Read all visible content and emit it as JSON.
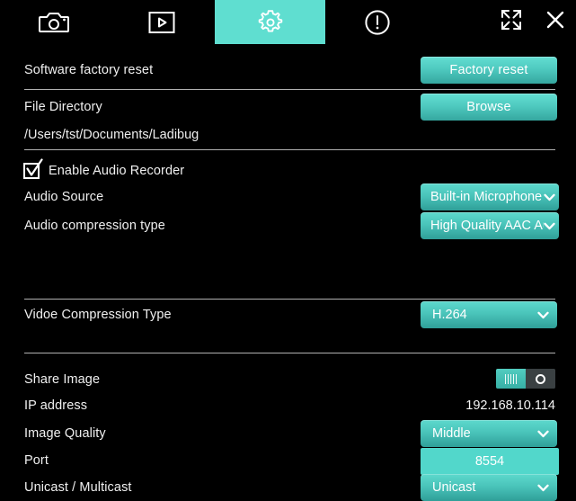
{
  "toolbar": {
    "tabs": [
      {
        "name": "camera",
        "icon": "camera-icon",
        "active": false
      },
      {
        "name": "playback",
        "icon": "play-icon",
        "active": false
      },
      {
        "name": "settings",
        "icon": "gear-icon",
        "active": true
      },
      {
        "name": "info",
        "icon": "exclamation-circle-icon",
        "active": false
      }
    ],
    "window_controls": [
      {
        "name": "expand",
        "icon": "fullscreen-icon"
      },
      {
        "name": "close",
        "icon": "close-icon"
      }
    ],
    "active_tab_color": "#5fded0"
  },
  "settings": {
    "factory_reset": {
      "label": "Software factory reset",
      "button": "Factory reset"
    },
    "file_directory": {
      "label": "File Directory",
      "button": "Browse",
      "path": "/Users/tst/Documents/Ladibug"
    },
    "audio_recorder": {
      "checkbox_label": "Enable Audio Recorder",
      "checked": true
    },
    "audio_source": {
      "label": "Audio Source",
      "value": "Built-in Microphone"
    },
    "audio_compression": {
      "label": "Audio compression type",
      "value": "High Quality AAC Au"
    },
    "video_compression": {
      "label": "Vidoe Compression Type",
      "value": "H.264"
    },
    "share_image": {
      "label": "Share Image",
      "toggle_state": "on"
    },
    "ip_address": {
      "label": "IP address",
      "value": "192.168.10.114"
    },
    "image_quality": {
      "label": "Image Quality",
      "value": "Middle"
    },
    "port": {
      "label": "Port",
      "value": "8554"
    },
    "cast_mode": {
      "label": "Unicast / Multicast",
      "value": "Unicast"
    }
  },
  "colors": {
    "accent": "#4fcac0",
    "accent_bright": "#5fded0",
    "field": "#52d7cb",
    "background": "#000000",
    "text": "#f2f2f2"
  }
}
